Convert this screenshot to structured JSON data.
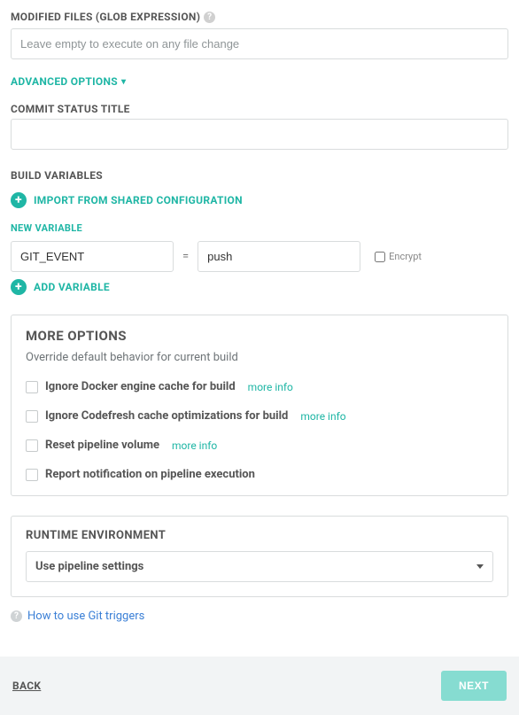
{
  "modified_files": {
    "label": "MODIFIED FILES (GLOB EXPRESSION)",
    "placeholder": "Leave empty to execute on any file change",
    "value": ""
  },
  "advanced_options_label": "ADVANCED OPTIONS",
  "commit_status": {
    "label": "COMMIT STATUS TITLE",
    "value": ""
  },
  "build_variables": {
    "label": "BUILD VARIABLES",
    "import_label": "IMPORT FROM SHARED CONFIGURATION",
    "new_var_label": "NEW VARIABLE",
    "key": "GIT_EVENT",
    "equals": "=",
    "value": "push",
    "encrypt_label": "Encrypt",
    "add_label": "ADD VARIABLE"
  },
  "more_options": {
    "title": "MORE OPTIONS",
    "subtitle": "Override default behavior for current build",
    "items": [
      {
        "label": "Ignore Docker engine cache for build",
        "more": "more info"
      },
      {
        "label": "Ignore Codefresh cache optimizations for build",
        "more": "more info"
      },
      {
        "label": "Reset pipeline volume",
        "more": "more info"
      },
      {
        "label": "Report notification on pipeline execution",
        "more": ""
      }
    ]
  },
  "runtime": {
    "title": "RUNTIME ENVIRONMENT",
    "selected": "Use pipeline settings"
  },
  "help_link": "How to use Git triggers",
  "footer": {
    "back": "BACK",
    "next": "NEXT"
  }
}
